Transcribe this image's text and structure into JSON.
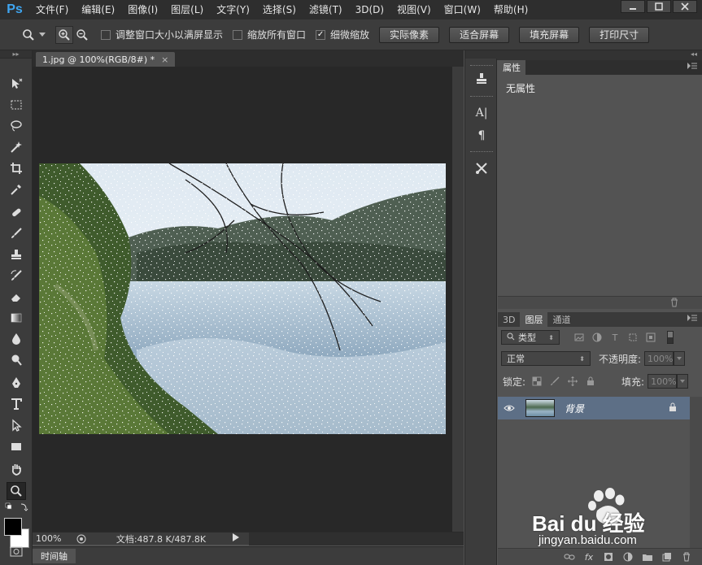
{
  "app": {
    "logo": "Ps"
  },
  "menu": [
    "文件(F)",
    "编辑(E)",
    "图像(I)",
    "图层(L)",
    "文字(Y)",
    "选择(S)",
    "滤镜(T)",
    "3D(D)",
    "视图(V)",
    "窗口(W)",
    "帮助(H)"
  ],
  "window_controls": [
    "minimize-icon",
    "maximize-icon",
    "close-icon"
  ],
  "options": {
    "tool_icon": "zoom-icon",
    "zoom_in_icon": "zoom-in-icon",
    "zoom_out_icon": "zoom-out-icon",
    "resize_windows": {
      "label": "调整窗口大小以满屏显示",
      "checked": false
    },
    "zoom_all_windows": {
      "label": "缩放所有窗口",
      "checked": false
    },
    "scrubby_zoom": {
      "label": "细微缩放",
      "checked": true
    },
    "actual_pixels": "实际像素",
    "fit_screen": "适合屏幕",
    "fill_screen": "填充屏幕",
    "print_size": "打印尺寸"
  },
  "tools": [
    "move-tool",
    "marquee-tool",
    "lasso-tool",
    "magic-wand-tool",
    "crop-tool",
    "eyedropper-tool",
    "healing-brush-tool",
    "brush-tool",
    "clone-stamp-tool",
    "history-brush-tool",
    "eraser-tool",
    "gradient-tool",
    "blur-tool",
    "dodge-tool",
    "pen-tool",
    "type-tool",
    "path-selection-tool",
    "rectangle-tool",
    "hand-tool",
    "zoom-tool"
  ],
  "document": {
    "tab_title": "1.jpg @ 100%(RGB/8#) *",
    "zoom": "100%",
    "doc_size": "文档:487.8 K/487.8K"
  },
  "timeline": {
    "label": "时间轴"
  },
  "properties": {
    "tab": "属性",
    "content": "无属性"
  },
  "layers": {
    "tabs": [
      "3D",
      "图层",
      "通道"
    ],
    "active_tab": "图层",
    "filter": "类型",
    "blend_mode": "正常",
    "opacity_label": "不透明度:",
    "opacity_value": "100%",
    "lock_label": "锁定:",
    "fill_label": "填充:",
    "fill_value": "100%",
    "layer_name": "背景"
  },
  "watermark": {
    "brand": "Bai du 经验",
    "url": "jingyan.baidu.com"
  },
  "colors": {
    "accent": "#3fa6f2",
    "selected_layer": "#5d6f86",
    "canvas_bg": "#282828",
    "panel_bg": "#535353"
  }
}
